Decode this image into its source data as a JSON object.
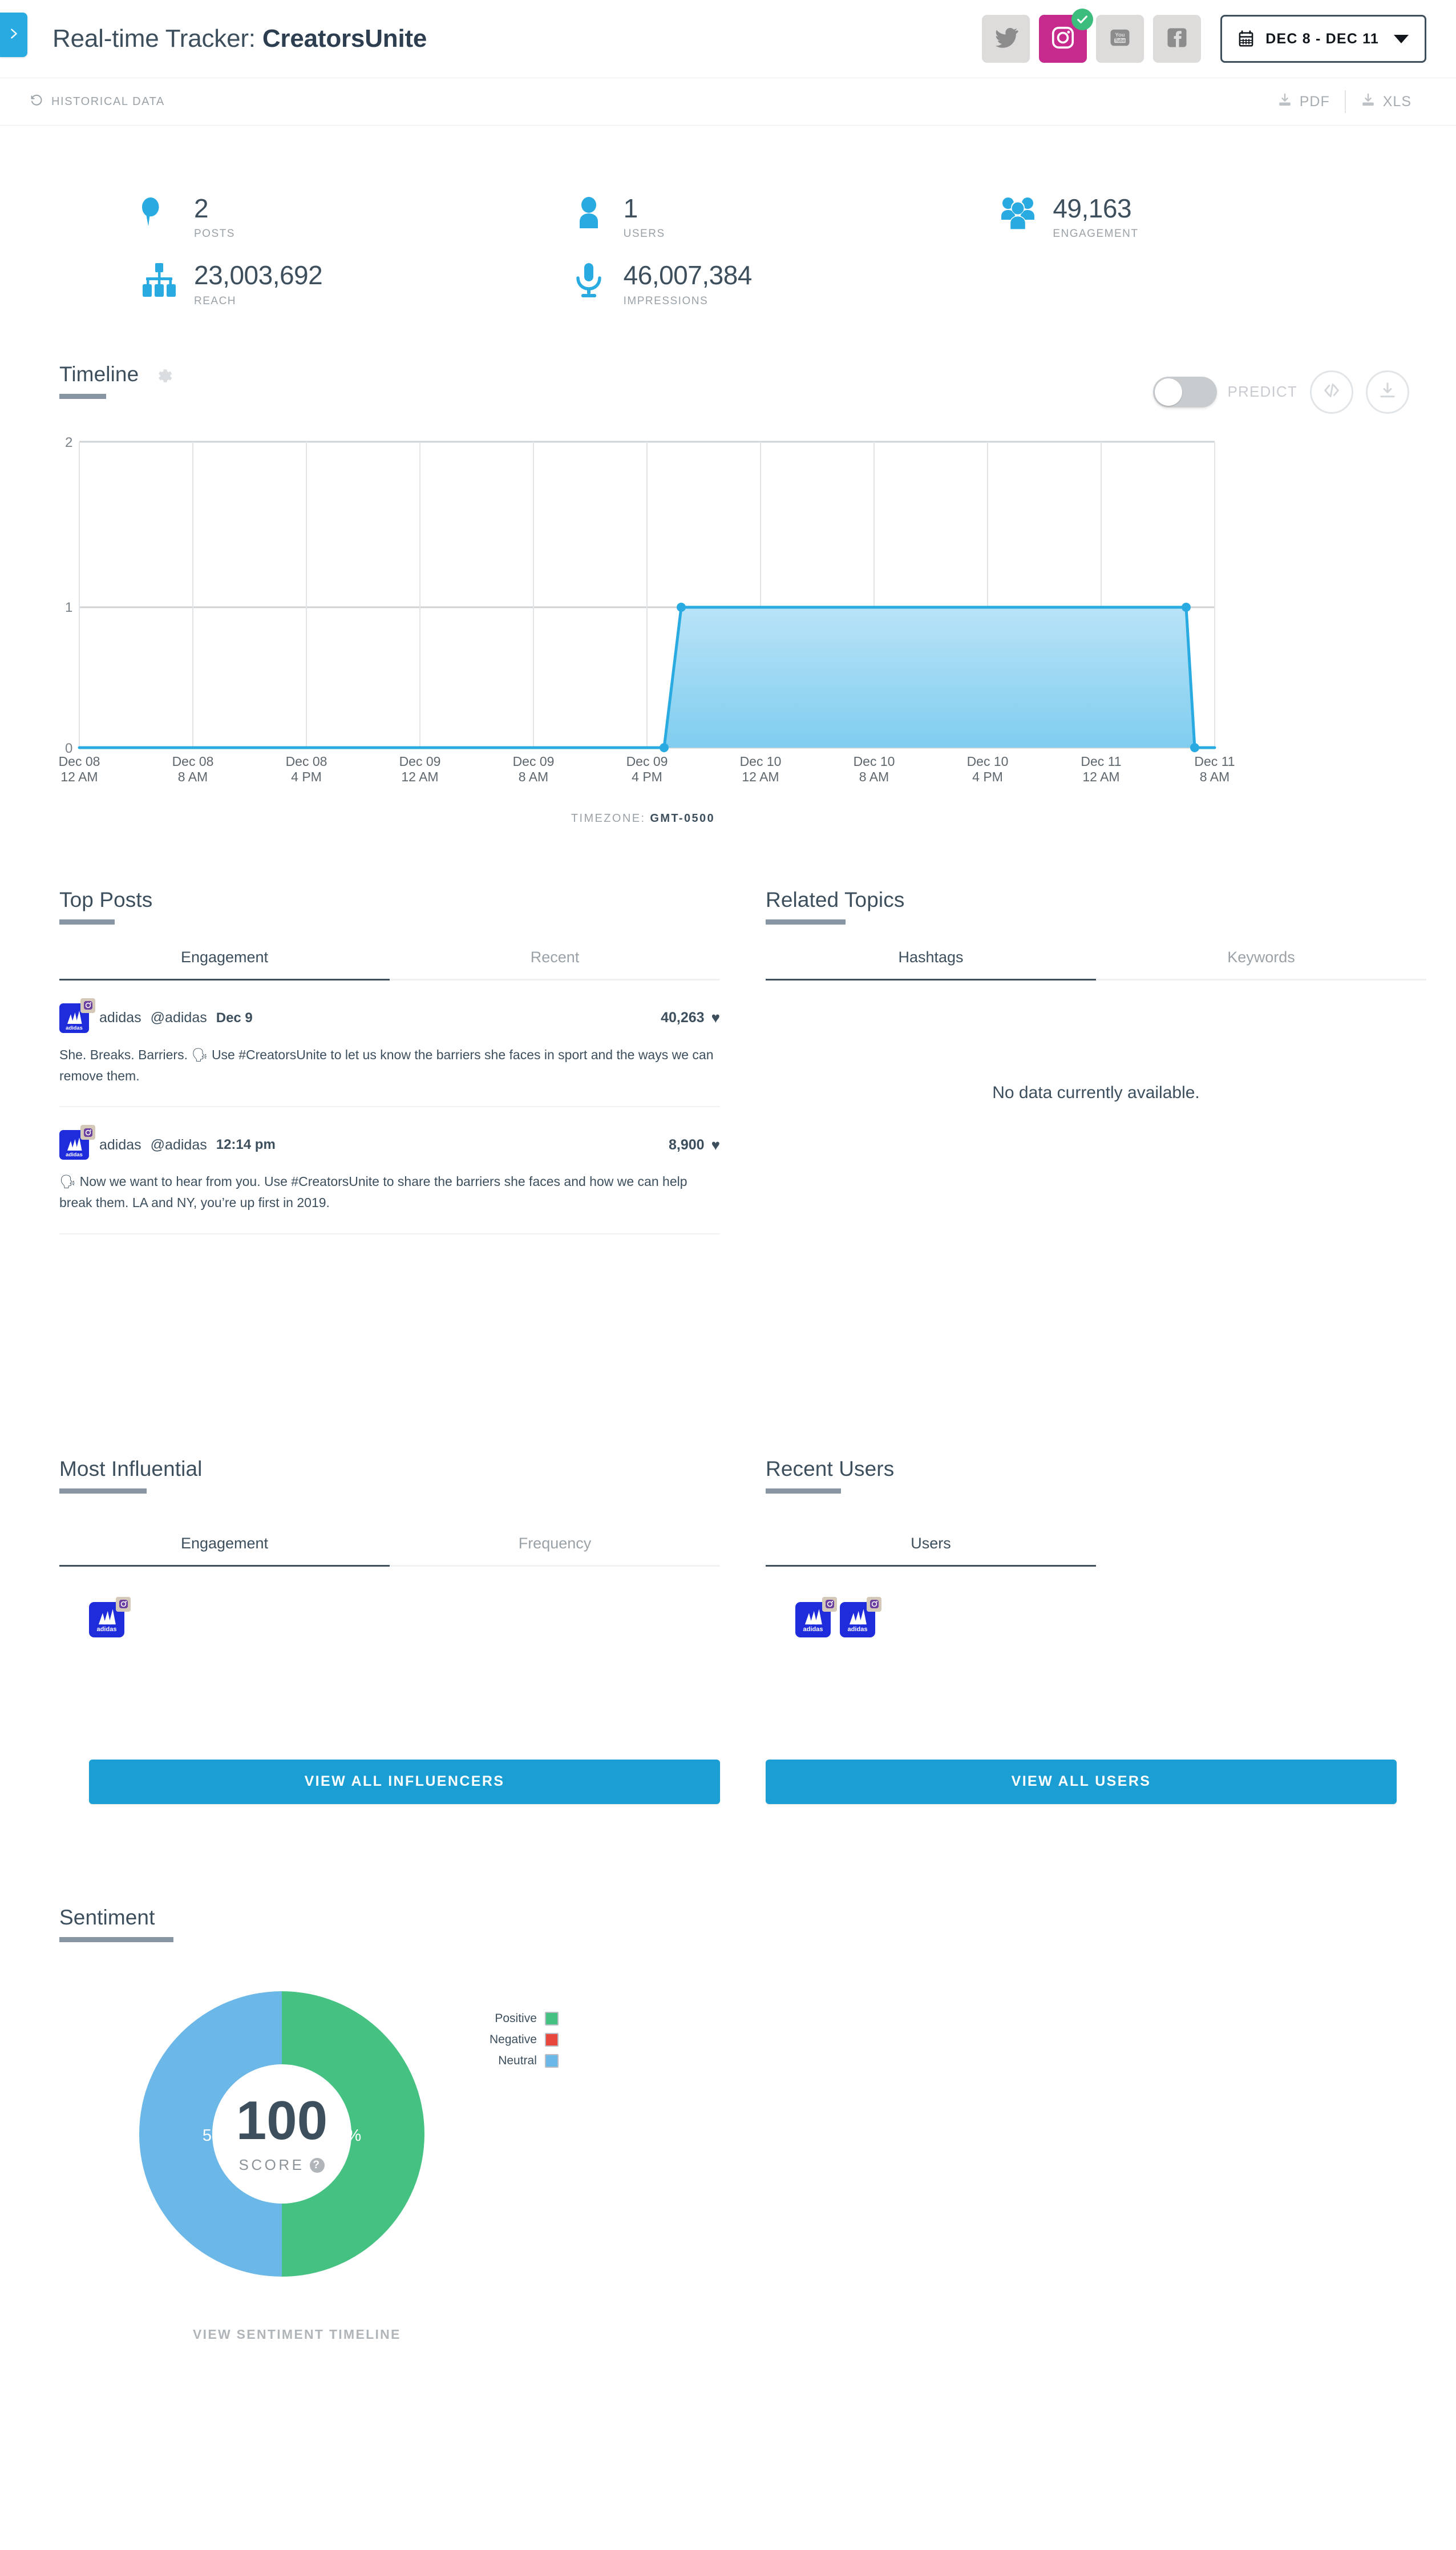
{
  "header": {
    "sidebar_toggle_icon": "chevron-right-icon",
    "title_prefix": "Real-time Tracker: ",
    "title_name": "CreatorsUnite",
    "social_networks": [
      {
        "name": "twitter",
        "icon": "twitter-icon",
        "active": false
      },
      {
        "name": "instagram",
        "icon": "instagram-icon",
        "active": true
      },
      {
        "name": "youtube",
        "icon": "youtube-icon",
        "active": false
      },
      {
        "name": "facebook",
        "icon": "facebook-icon",
        "active": false
      }
    ],
    "date_range": "DEC 8 - DEC 11",
    "date_icon": "calendar-icon",
    "caret_icon": "chevron-down-icon"
  },
  "subbar": {
    "historical_label": "HISTORICAL DATA",
    "historical_icon": "history-icon",
    "pdf_label": "PDF",
    "xls_label": "XLS",
    "download_icon": "download-icon"
  },
  "stats": [
    {
      "value": "2",
      "label": "POSTS",
      "icon": "comment-bubble-icon"
    },
    {
      "value": "1",
      "label": "USERS",
      "icon": "user-icon"
    },
    {
      "value": "49,163",
      "label": "ENGAGEMENT",
      "icon": "users-group-icon"
    },
    {
      "value": "23,003,692",
      "label": "REACH",
      "icon": "sitemap-icon"
    },
    {
      "value": "46,007,384",
      "label": "IMPRESSIONS",
      "icon": "microphone-icon"
    }
  ],
  "timeline": {
    "title": "Timeline",
    "gear_icon": "gear-icon",
    "predict_label": "PREDICT",
    "predict_on": false,
    "embed_icon": "code-icon",
    "download_icon": "download-icon",
    "timezone_label": "TIMEZONE:",
    "timezone_value": "GMT-0500"
  },
  "chart_data": {
    "type": "area",
    "title": "Timeline",
    "xlabel": "",
    "ylabel": "",
    "ylim": [
      0,
      2
    ],
    "yticks": [
      "0",
      "1",
      "2"
    ],
    "grid": true,
    "legend": "none",
    "tick_labels": [
      {
        "day": "Dec 08",
        "time": "12 AM"
      },
      {
        "day": "Dec 08",
        "time": "8 AM"
      },
      {
        "day": "Dec 08",
        "time": "4 PM"
      },
      {
        "day": "Dec 09",
        "time": "12 AM"
      },
      {
        "day": "Dec 09",
        "time": "8 AM"
      },
      {
        "day": "Dec 09",
        "time": "4 PM"
      },
      {
        "day": "Dec 10",
        "time": "12 AM"
      },
      {
        "day": "Dec 10",
        "time": "8 AM"
      },
      {
        "day": "Dec 10",
        "time": "4 PM"
      },
      {
        "day": "Dec 11",
        "time": "12 AM"
      },
      {
        "day": "Dec 11",
        "time": "8 AM"
      }
    ],
    "x": [
      "Dec 08 12 AM",
      "Dec 08 8 AM",
      "Dec 08 4 PM",
      "Dec 09 12 AM",
      "Dec 09 8 AM",
      "Dec 09 4 PM",
      "Dec 09 10 PM",
      "Dec 10 12 AM",
      "Dec 10 8 AM",
      "Dec 10 4 PM",
      "Dec 11 12 AM",
      "Dec 11 8 AM",
      "Dec 11 12 PM"
    ],
    "values": [
      0,
      0,
      0,
      0,
      0,
      0,
      1,
      1,
      1,
      1,
      1,
      1,
      0
    ],
    "series": [
      {
        "name": "Posts",
        "values": [
          0,
          0,
          0,
          0,
          0,
          0,
          1,
          1,
          1,
          1,
          1,
          1,
          0
        ],
        "color": "#29abe2"
      }
    ]
  },
  "top_posts": {
    "title": "Top Posts",
    "tabs": [
      {
        "label": "Engagement",
        "active": true
      },
      {
        "label": "Recent",
        "active": false
      }
    ],
    "items": [
      {
        "name": "adidas",
        "handle": "@adidas",
        "time": "Dec 9",
        "metric": "40,263",
        "metric_icon": "heart-icon",
        "network_icon": "instagram-icon",
        "avatar_icon": "adidas-logo-icon",
        "text": "She. Breaks. Barriers. 🗣 Use #CreatorsUnite to let us know the barriers she faces in sport and the ways we can remove them."
      },
      {
        "name": "adidas",
        "handle": "@adidas",
        "time": "12:14 pm",
        "metric": "8,900",
        "metric_icon": "heart-icon",
        "network_icon": "instagram-icon",
        "avatar_icon": "adidas-logo-icon",
        "text": "🗣 Now we want to hear from you. Use #CreatorsUnite to share the barriers she faces and how we can help break them. LA and NY, you’re up first in 2019."
      }
    ]
  },
  "related_topics": {
    "title": "Related Topics",
    "tabs": [
      {
        "label": "Hashtags",
        "active": true
      },
      {
        "label": "Keywords",
        "active": false
      }
    ],
    "empty_message": "No data currently available."
  },
  "most_influential": {
    "title": "Most Influential",
    "tabs": [
      {
        "label": "Engagement",
        "active": true
      },
      {
        "label": "Frequency",
        "active": false
      }
    ],
    "avatars": [
      {
        "name": "adidas",
        "icon": "adidas-logo-icon",
        "network_icon": "instagram-icon"
      }
    ]
  },
  "recent_users": {
    "title": "Recent Users",
    "tabs": [
      {
        "label": "Users",
        "active": true
      }
    ],
    "avatars": [
      {
        "name": "adidas",
        "icon": "adidas-logo-icon",
        "network_icon": "instagram-icon"
      },
      {
        "name": "adidas",
        "icon": "adidas-logo-icon",
        "network_icon": "instagram-icon"
      }
    ]
  },
  "cta": {
    "influencers_label": "VIEW ALL INFLUENCERS",
    "users_label": "VIEW ALL USERS"
  },
  "sentiment": {
    "title": "Sentiment",
    "score": "100",
    "score_label": "SCORE",
    "help_icon": "question-mark-icon",
    "left_percent": "50.0%",
    "right_percent": "50.0%",
    "view_timeline_label": "VIEW SENTIMENT TIMELINE",
    "legend": [
      {
        "label": "Positive",
        "color": "#45c281"
      },
      {
        "label": "Negative",
        "color": "#e8483c"
      },
      {
        "label": "Neutral",
        "color": "#6ab7e8"
      }
    ],
    "slices": [
      {
        "label": "Positive",
        "percent": 50.0,
        "color": "#45c281"
      },
      {
        "label": "Neutral",
        "percent": 50.0,
        "color": "#6ab7e8"
      }
    ]
  },
  "colors": {
    "accent": "#29abe2",
    "cta": "#1b9ed4",
    "dark": "#3d4f5d",
    "muted": "#9aa2a8",
    "instagram": "#c72a8d",
    "check": "#3dbd7d",
    "positive": "#45c281",
    "negative": "#e8483c",
    "neutral": "#6ab7e8"
  }
}
